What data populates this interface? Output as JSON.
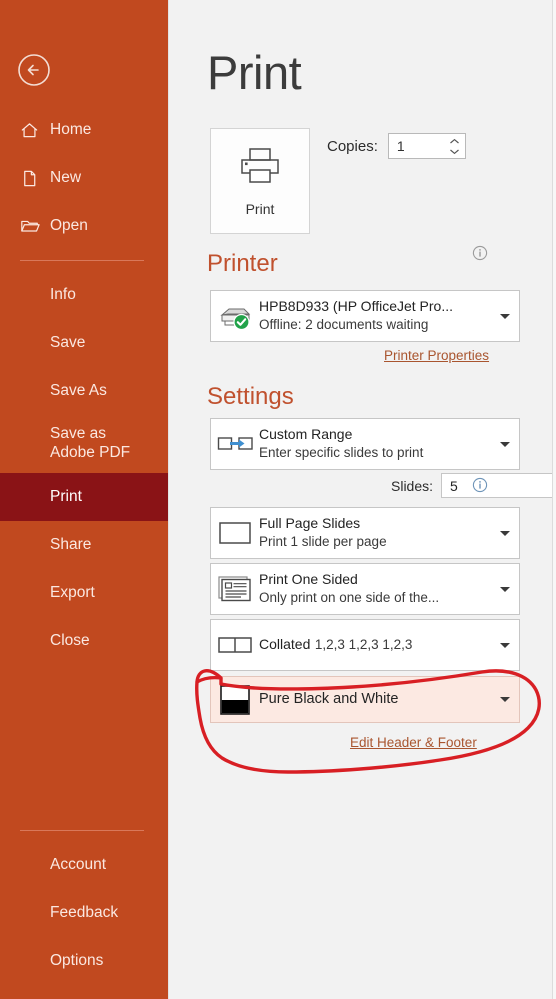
{
  "sidebar": {
    "back_label": "Back",
    "items_top": [
      {
        "label": "Home",
        "icon": "home-icon"
      },
      {
        "label": "New",
        "icon": "new-document-icon"
      },
      {
        "label": "Open",
        "icon": "open-folder-icon"
      }
    ],
    "items_mid": [
      {
        "label": "Info",
        "selected": false
      },
      {
        "label": "Save",
        "selected": false
      },
      {
        "label": "Save As",
        "selected": false
      },
      {
        "label": "Save as Adobe PDF",
        "selected": false
      },
      {
        "label": "Print",
        "selected": true
      },
      {
        "label": "Share",
        "selected": false
      },
      {
        "label": "Export",
        "selected": false
      },
      {
        "label": "Close",
        "selected": false
      }
    ],
    "items_bottom": [
      {
        "label": "Account"
      },
      {
        "label": "Feedback"
      },
      {
        "label": "Options"
      }
    ],
    "colors": {
      "background": "#c1491f",
      "selected": "#8a1316",
      "text": "#fbe8e1"
    }
  },
  "main": {
    "title": "Print",
    "print_button_label": "Print",
    "copies_label": "Copies:",
    "copies_value": "1",
    "printer": {
      "heading": "Printer",
      "name": "HPB8D933 (HP OfficeJet Pro...",
      "status": "Offline: 2 documents waiting",
      "properties_link": "Printer Properties"
    },
    "settings": {
      "heading": "Settings",
      "range": {
        "line1": "Custom Range",
        "line2": "Enter specific slides to print"
      },
      "slides_label": "Slides:",
      "slides_value": "5",
      "layout": {
        "line1": "Full Page Slides",
        "line2": "Print 1 slide per page"
      },
      "sides": {
        "line1": "Print One Sided",
        "line2": "Only print on one side of the..."
      },
      "collation": {
        "line1": "Collated",
        "line2": "1,2,3   1,2,3   1,2,3"
      },
      "color": {
        "line1": "Pure Black and White",
        "line2": ""
      },
      "header_footer_link": "Edit Header & Footer"
    },
    "colors": {
      "accent": "#c0512e",
      "link": "#a9552f",
      "background": "#f2f2f2",
      "annotation": "#d81f24"
    }
  }
}
